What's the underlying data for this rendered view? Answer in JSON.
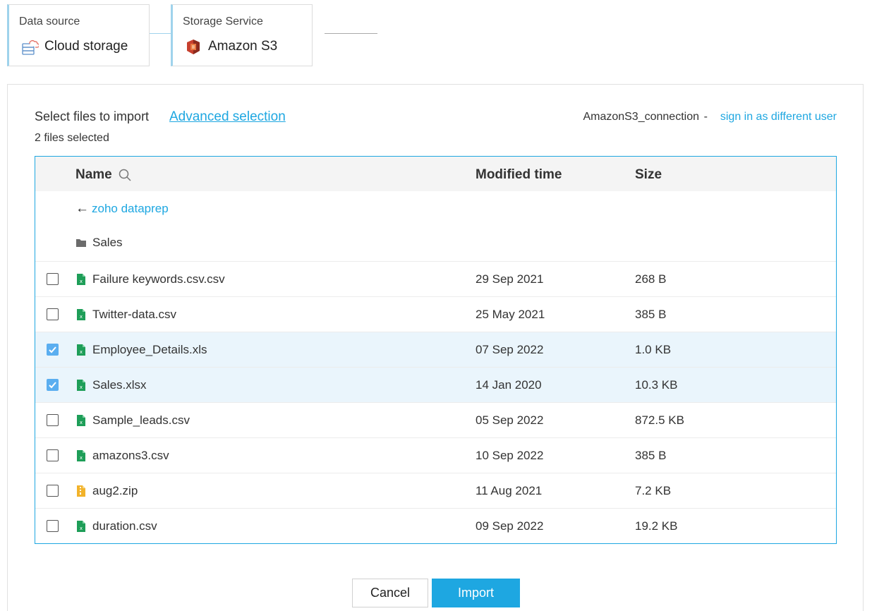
{
  "stepper": {
    "step1": {
      "label": "Data source",
      "value": "Cloud storage",
      "icon": "cloud-storage-icon"
    },
    "step2": {
      "label": "Storage Service",
      "value": "Amazon S3",
      "icon": "amazon-s3-icon"
    }
  },
  "panel": {
    "title": "Select files to import",
    "advanced_link": "Advanced selection",
    "files_selected": "2 files selected",
    "connection_name": "AmazonS3_connection",
    "separator": "-",
    "switch_user_link": "sign in as different user"
  },
  "table": {
    "headers": {
      "name": "Name",
      "modified": "Modified time",
      "size": "Size"
    },
    "back_link": "zoho dataprep",
    "folder": "Sales",
    "files": [
      {
        "name": "Failure keywords.csv.csv",
        "modified": "29 Sep 2021",
        "size": "268 B",
        "checked": false,
        "type": "spreadsheet"
      },
      {
        "name": "Twitter-data.csv",
        "modified": "25 May 2021",
        "size": "385 B",
        "checked": false,
        "type": "spreadsheet"
      },
      {
        "name": "Employee_Details.xls",
        "modified": "07 Sep 2022",
        "size": "1.0 KB",
        "checked": true,
        "type": "spreadsheet"
      },
      {
        "name": "Sales.xlsx",
        "modified": "14 Jan 2020",
        "size": "10.3 KB",
        "checked": true,
        "type": "spreadsheet"
      },
      {
        "name": "Sample_leads.csv",
        "modified": "05 Sep 2022",
        "size": "872.5 KB",
        "checked": false,
        "type": "spreadsheet"
      },
      {
        "name": "amazons3.csv",
        "modified": "10 Sep 2022",
        "size": "385 B",
        "checked": false,
        "type": "spreadsheet"
      },
      {
        "name": "aug2.zip",
        "modified": "11 Aug 2021",
        "size": "7.2 KB",
        "checked": false,
        "type": "zip"
      },
      {
        "name": "duration.csv",
        "modified": "09 Sep 2022",
        "size": "19.2 KB",
        "checked": false,
        "type": "spreadsheet"
      }
    ]
  },
  "buttons": {
    "cancel": "Cancel",
    "import": "Import"
  },
  "colors": {
    "accent": "#1ea7e1",
    "selected_row": "#eaf5fc",
    "checkbox_checked": "#5aaef0",
    "spreadsheet_icon": "#1e9e58",
    "zip_icon": "#f2b32b"
  }
}
